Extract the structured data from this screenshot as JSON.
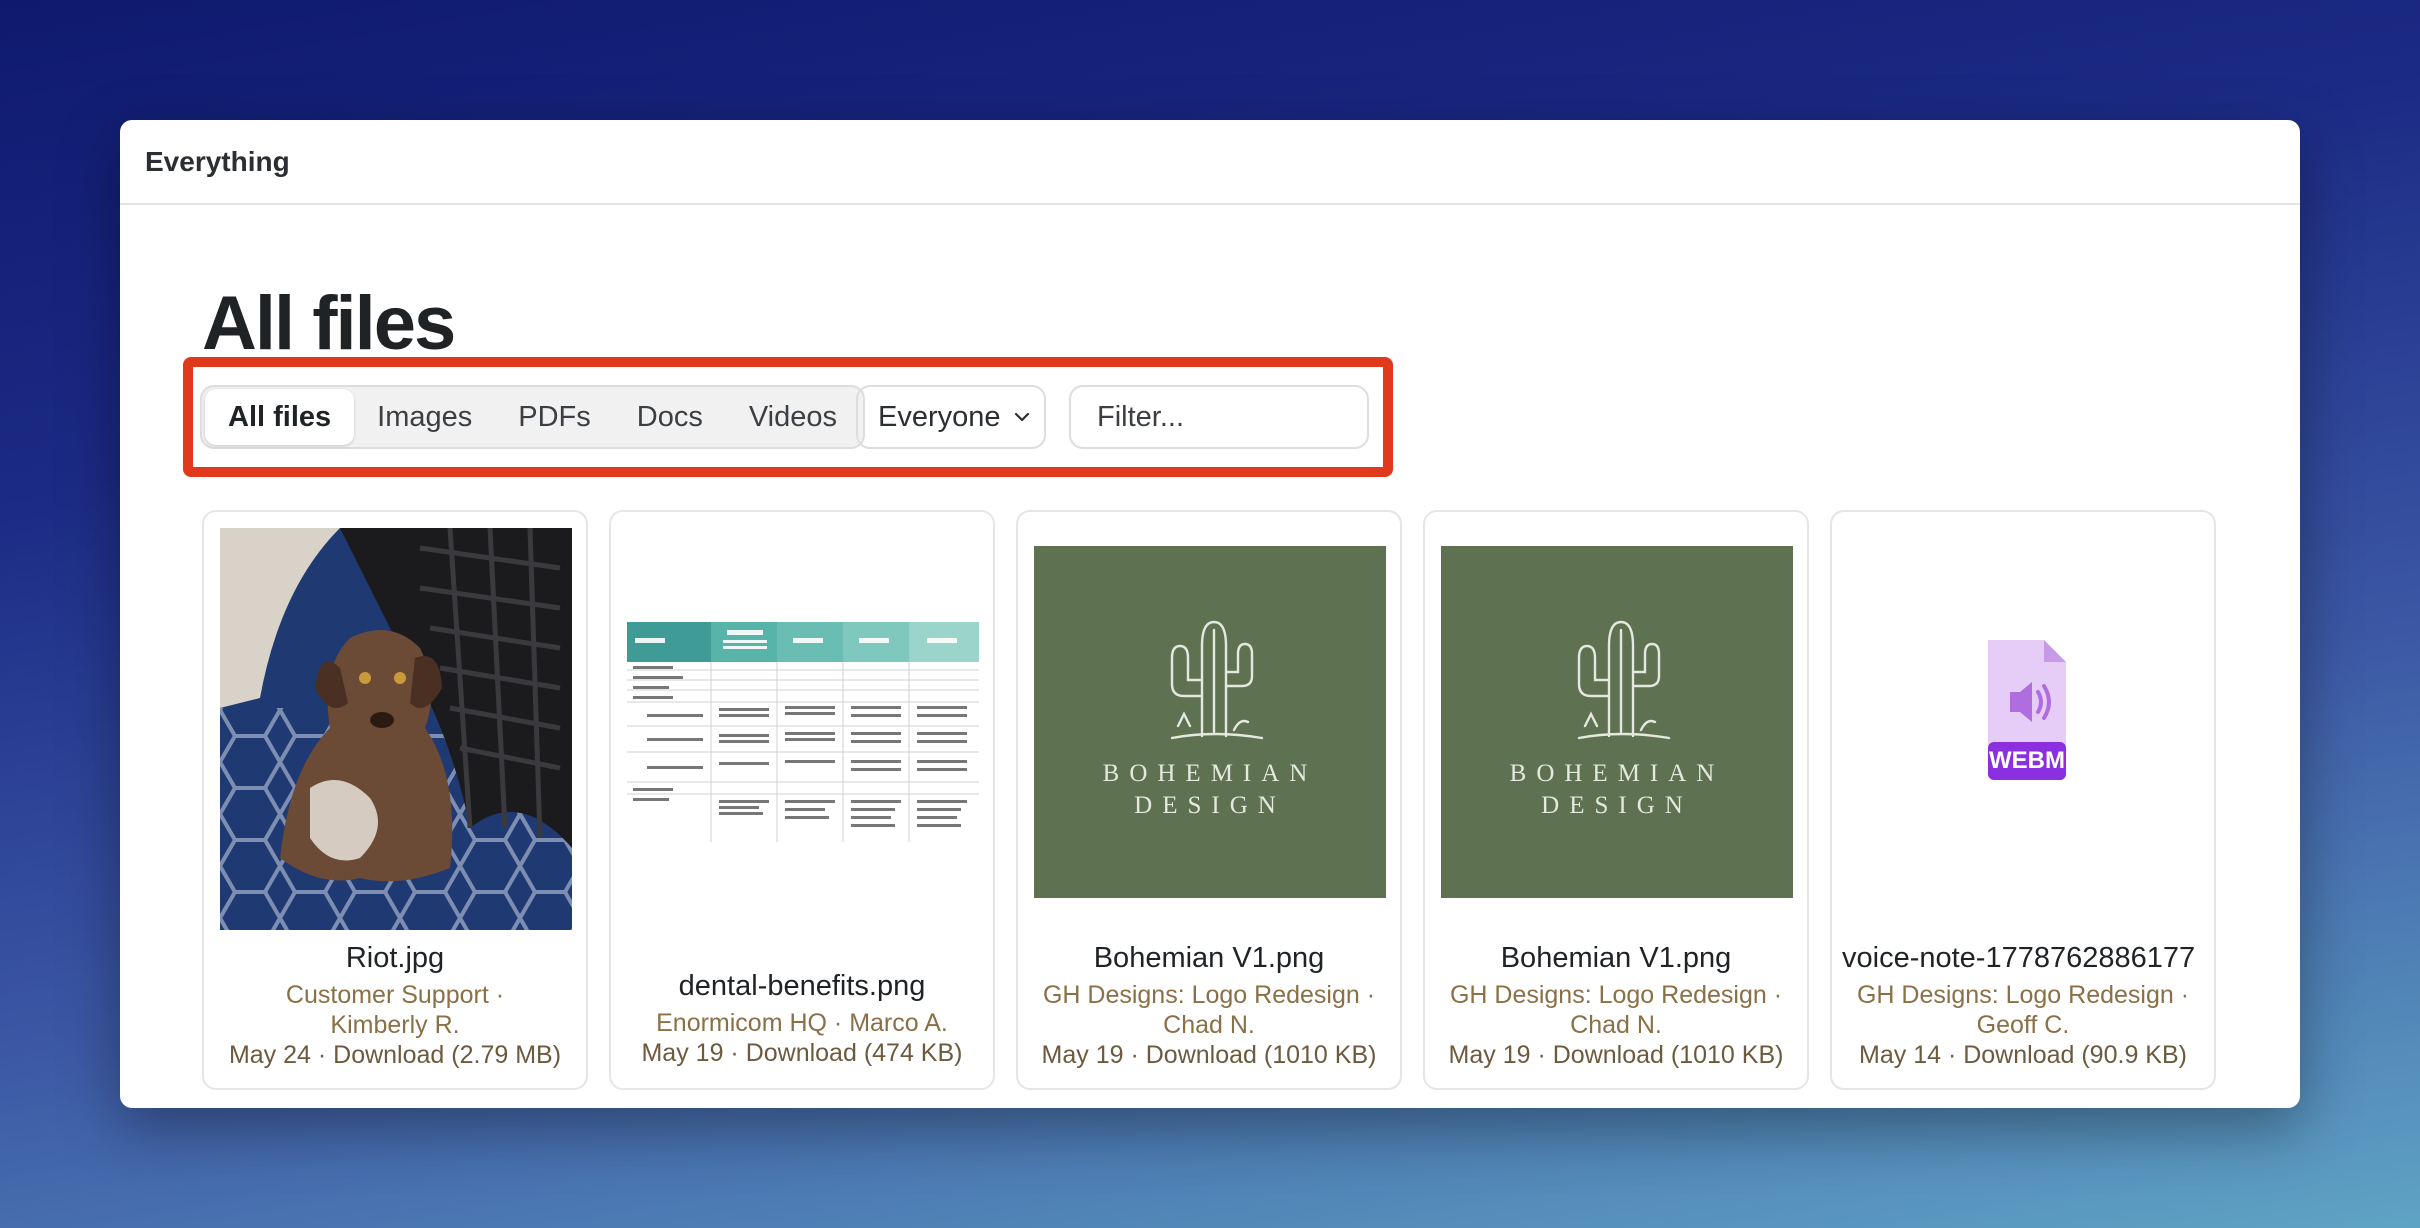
{
  "window": {
    "title": "Everything"
  },
  "page": {
    "title": "All files"
  },
  "tabs": [
    {
      "label": "All files",
      "active": true
    },
    {
      "label": "Images",
      "active": false
    },
    {
      "label": "PDFs",
      "active": false
    },
    {
      "label": "Docs",
      "active": false
    },
    {
      "label": "Videos",
      "active": false
    }
  ],
  "people_filter": {
    "selected": "Everyone"
  },
  "filter": {
    "placeholder": "Filter..."
  },
  "highlight_color": "#e0391c",
  "files": [
    {
      "name": "Riot.jpg",
      "line1": "Customer Support ·",
      "line2": "Kimberly R.",
      "date": "May 24",
      "download_label": "Download",
      "size": "(2.79 MB)",
      "thumb": "dog-photo"
    },
    {
      "name": "dental-benefits.png",
      "line1": "Enormicom HQ · Marco A.",
      "line2": "",
      "date": "May 19",
      "download_label": "Download",
      "size": "(474 KB)",
      "thumb": "table-document"
    },
    {
      "name": "Bohemian V1.png",
      "line1": "GH Designs: Logo Redesign ·",
      "line2": "Chad N.",
      "date": "May 19",
      "download_label": "Download",
      "size": "(1010 KB)",
      "thumb": "bohemian-logo",
      "logo_text": [
        "BOHEMIAN",
        "DESIGN"
      ]
    },
    {
      "name": "Bohemian V1.png",
      "line1": "GH Designs: Logo Redesign ·",
      "line2": "Chad N.",
      "date": "May 19",
      "download_label": "Download",
      "size": "(1010 KB)",
      "thumb": "bohemian-logo",
      "logo_text": [
        "BOHEMIAN",
        "DESIGN"
      ]
    },
    {
      "name": "voice-note-1778762886177",
      "line1": "GH Designs: Logo Redesign ·",
      "line2": "Geoff C.",
      "date": "May 14",
      "download_label": "Download",
      "size": "(90.9 KB)",
      "thumb": "webm-file-icon",
      "badge": "WEBM"
    }
  ]
}
